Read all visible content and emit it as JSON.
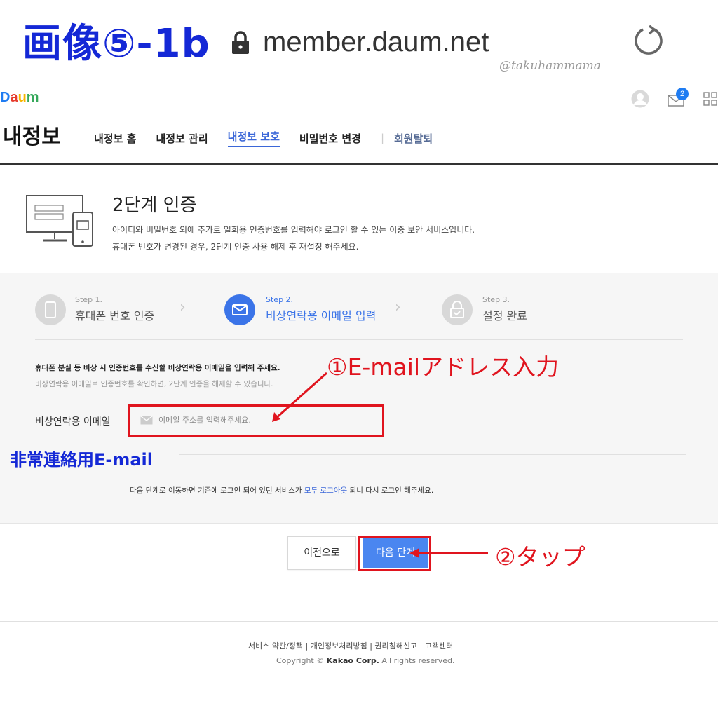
{
  "annotation": {
    "image_label": "画像⑤-1b",
    "watermark": "@takuhammama",
    "step1_text": "①E-mailアドレス入力",
    "email_jp_label": "非常連絡用E-mail",
    "step2_text": "②タップ",
    "highlight_color": "#e0141e",
    "label_color": "#1428d6"
  },
  "browser": {
    "url": "member.daum.net",
    "icons": [
      "lock-icon",
      "reload-icon"
    ]
  },
  "header": {
    "logo": "Daum",
    "mail_badge_count": "2",
    "icons": [
      "avatar-icon",
      "mail-icon",
      "app-grid-icon"
    ]
  },
  "page": {
    "title": "내정보",
    "nav": [
      {
        "label": "내정보 홈"
      },
      {
        "label": "내정보 관리"
      },
      {
        "label": "내정보 보호",
        "active": true
      },
      {
        "label": "비밀번호 변경"
      },
      {
        "label": "회원탈퇴"
      }
    ]
  },
  "auth": {
    "title": "2단계 인증",
    "desc1": "아이디와 비밀번호 외에 추가로 일회용 인증번호를 입력해야 로그인 할 수 있는 이중 보안 서비스입니다.",
    "desc2": "휴대폰 번호가 변경된 경우, 2단계 인증 사용 해제 후 재설정 해주세요."
  },
  "steps": [
    {
      "small": "Step 1.",
      "label": "휴대폰 번호 인증",
      "active": false
    },
    {
      "small": "Step 2.",
      "label": "비상연락용 이메일 입력",
      "active": true
    },
    {
      "small": "Step 3.",
      "label": "설정 완료",
      "active": false
    }
  ],
  "form": {
    "guide1": "휴대폰 분실 등 비상 시 인증번호를 수신할 비상연락용 이메일을 입력해 주세요.",
    "guide2": "비상연락용 이메일로 인증번호를 확인하면, 2단계 인증을 해제할 수 있습니다.",
    "email_label": "비상연락용 이메일",
    "email_placeholder": "이메일 주소를 입력해주세요.",
    "email_value": "",
    "note_before": "다음 단계로 이동하면 기존에 로그인 되어 있던 서비스가 ",
    "note_link": "모두 로그아웃",
    "note_after": " 되니 다시 로그인 해주세요."
  },
  "buttons": {
    "prev": "이전으로",
    "next": "다음 단계"
  },
  "footer": {
    "links": "서비스 약관/정책 | 개인정보처리방침 | 권리침해신고 | 고객센터",
    "copyright_prefix": "Copyright © ",
    "copyright_company": "Kakao Corp.",
    "copyright_suffix": " All rights reserved."
  },
  "colors": {
    "accent": "#3b67d8",
    "button_primary": "#4a86f0",
    "panel_bg": "#f6f6f6"
  }
}
